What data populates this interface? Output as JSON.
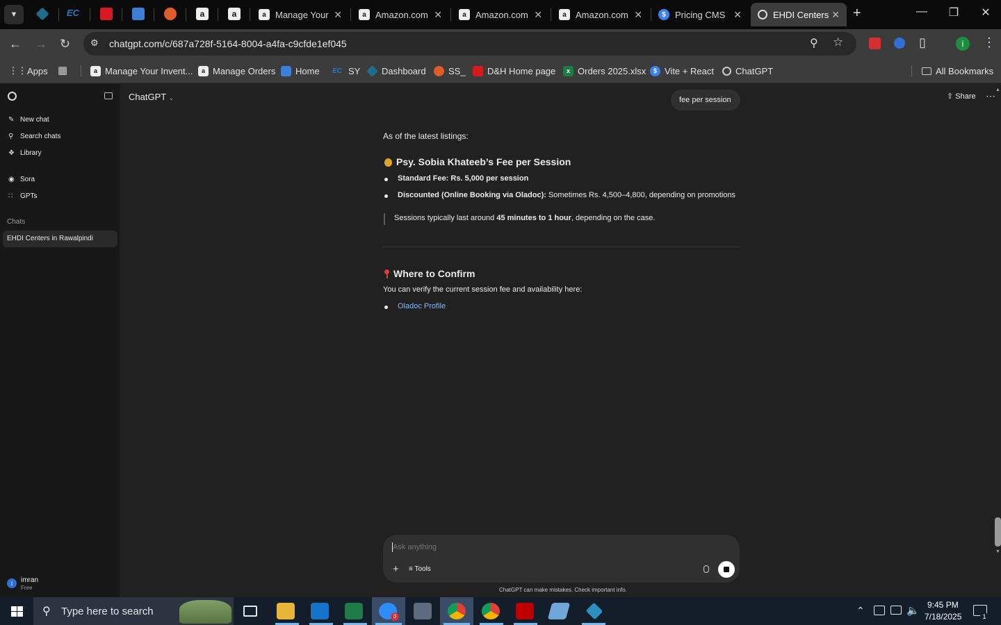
{
  "browser": {
    "tabs": [
      {
        "label": "Manage Your",
        "icon": "amazon-icon"
      },
      {
        "label": "Amazon.com",
        "icon": "amazon-icon"
      },
      {
        "label": "Amazon.com",
        "icon": "amazon-icon"
      },
      {
        "label": "Amazon.com",
        "icon": "amazon-icon"
      },
      {
        "label": "Pricing CMS",
        "icon": "dollar-icon"
      },
      {
        "label": "EHDI Centers",
        "icon": "chatgpt-icon"
      }
    ],
    "new_tab": "+",
    "url": "chatgpt.com/c/687a728f-5164-8004-a4fa-c9cfde1ef045",
    "bookmarks": [
      {
        "label": "Apps"
      },
      {
        "label": "Manage Your Invent..."
      },
      {
        "label": "Manage Orders"
      },
      {
        "label": "Home"
      },
      {
        "label": "SY"
      },
      {
        "label": "Dashboard"
      },
      {
        "label": "SS_"
      },
      {
        "label": "D&H Home page"
      },
      {
        "label": "Orders 2025.xlsx"
      },
      {
        "label": "Vite + React"
      },
      {
        "label": "ChatGPT"
      }
    ],
    "all_bookmarks": "All Bookmarks",
    "profile_initial": "i"
  },
  "sidebar": {
    "new_chat": "New chat",
    "search_chats": "Search chats",
    "library": "Library",
    "sora": "Sora",
    "gpts": "GPTs",
    "chats_heading": "Chats",
    "chat_items": [
      "EHDI Centers in Rawalpindi"
    ],
    "user_name": "imran",
    "user_plan": "Free",
    "user_initial": "i"
  },
  "header": {
    "model": "ChatGPT",
    "share": "Share",
    "tooltip": "fee per session"
  },
  "conversation": {
    "intro": "As of the latest listings:",
    "section1_title": "Psy. Sobia Khateeb’s Fee per Session",
    "bullet1": "Standard Fee: Rs. 5,000 per session",
    "bullet2_bold": "Discounted (Online Booking via Oladoc):",
    "bullet2_rest": " Sometimes Rs. 4,500–4,800, depending on promotions",
    "quote_a": "Sessions typically last around ",
    "quote_b": "45 minutes to 1 hour",
    "quote_c": ", depending on the case.",
    "section2_title": "Where to Confirm",
    "verify_text": "You can verify the current session fee and availability here:",
    "link_text": "Oladoc Profile"
  },
  "composer": {
    "placeholder": "Ask anything",
    "tools": "Tools",
    "disclaimer": "ChatGPT can make mistakes. Check important info."
  },
  "taskbar": {
    "search_placeholder": "Type here to search",
    "time": "9:45 PM",
    "date": "7/18/2025",
    "notifications": "1",
    "zoom_badge": "3"
  },
  "colors": {
    "accent_link": "#7ab7ff",
    "taskbar_bg": "#141e2a",
    "sidebar_bg": "#181818",
    "main_bg": "#212121"
  }
}
